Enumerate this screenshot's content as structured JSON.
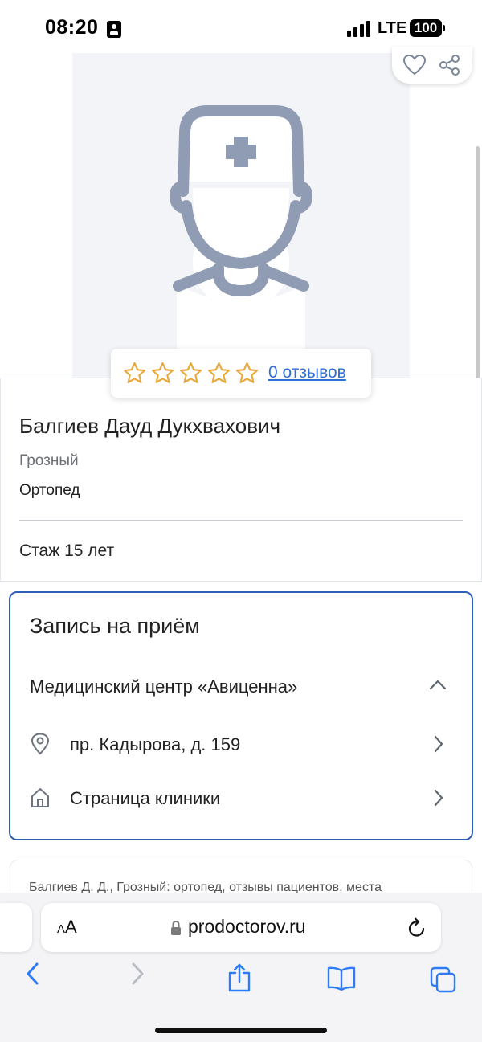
{
  "status_bar": {
    "time": "08:20",
    "network": "LTE",
    "battery": "100",
    "signal_bars": 4
  },
  "profile": {
    "photo_icon": "doctor-placeholder-icon",
    "rating": {
      "stars_filled": 0,
      "stars_total": 5,
      "reviews_link": "0 отзывов"
    },
    "name": "Балгиев Дауд Дукхвахович",
    "city": "Грозный",
    "specialty": "Ортопед",
    "experience": "Стаж 15 лет"
  },
  "appointment": {
    "title": "Запись на приём",
    "clinic_name": "Медицинский центр «Авиценна»",
    "address": "пр. Кадырова, д. 159",
    "clinic_page": "Страница клиники"
  },
  "description_teaser": "Балгиев Д. Д., Грозный: ортопед, отзывы пациентов, места",
  "browser": {
    "text_size_label_small": "A",
    "text_size_label_large": "A",
    "url": "prodoctorov.ru"
  },
  "colors": {
    "accent": "#2f5fb8",
    "link": "#2f6fd6",
    "star": "#e8a93a",
    "placeholder": "#8f9cb3",
    "safari_blue": "#2f7bf5"
  }
}
